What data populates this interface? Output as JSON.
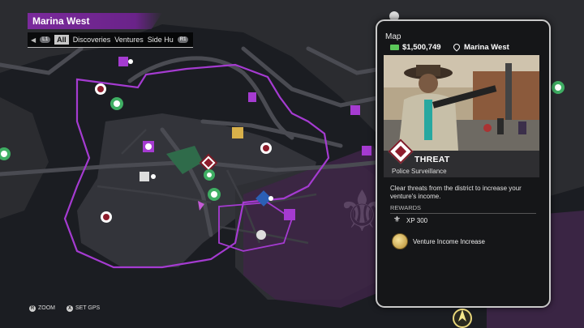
{
  "header": {
    "district": "Marina West",
    "filter_tabs": [
      {
        "label": "All",
        "active": true
      },
      {
        "label": "Discoveries",
        "active": false
      },
      {
        "label": "Ventures",
        "active": false
      },
      {
        "label": "Side Hu",
        "active": false
      }
    ],
    "left_button_glyph": "L1",
    "right_button_glyph": "R1"
  },
  "card": {
    "title": "Map",
    "money": "$1,500,749",
    "district": "Marina West",
    "activity_type": "THREAT",
    "activity_name": "Police Surveillance",
    "description": "Clear threats from the district to increase your venture's income.",
    "rewards_heading": "REWARDS",
    "rewards": [
      {
        "icon": "fleur-de-lis-icon",
        "label": "XP 300"
      },
      {
        "icon": "venture-income-coin-icon",
        "label": "Venture Income Increase"
      }
    ]
  },
  "hints": [
    {
      "button": "R",
      "label": "ZOOM"
    },
    {
      "button": "X",
      "label": "SET GPS"
    }
  ],
  "colors": {
    "accent_purple": "#7b2a9c",
    "territory_purple": "#a53bd1",
    "threat_red": "#8e1d2c",
    "money_green": "#5cc85a"
  }
}
